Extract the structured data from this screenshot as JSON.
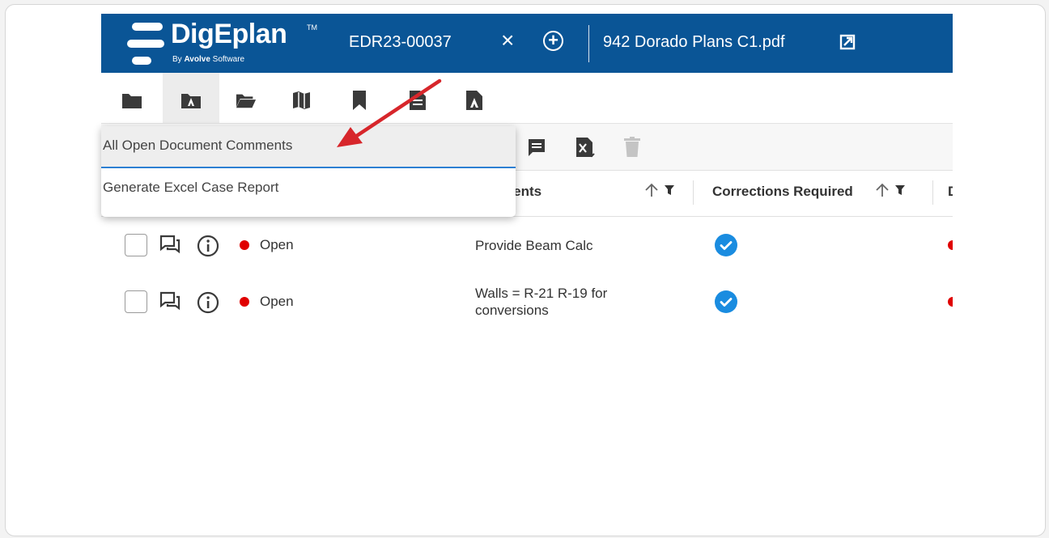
{
  "header": {
    "logo_text": "DigEplan",
    "logo_tm": "TM",
    "logo_sub_prefix": "By",
    "logo_sub_brand": "Avolve",
    "logo_sub_suffix": "Software",
    "case_id": "EDR23-00037",
    "close_glyph": "×",
    "add_glyph": "+",
    "document_name": "942 Dorado Plans C1.pdf"
  },
  "toolbar": {
    "icons": [
      "folder-icon",
      "folder-tag-icon",
      "folder-open-icon",
      "map-icon",
      "bookmark-icon",
      "document-icon",
      "document-tag-icon"
    ],
    "active_index": 1
  },
  "actions": {
    "icons": [
      "comment-icon",
      "excel-export-icon",
      "trash-icon"
    ]
  },
  "dropdown": {
    "items": [
      {
        "label": "All Open Document Comments",
        "highlighted": true
      },
      {
        "label": "Generate Excel Case Report",
        "highlighted": false
      }
    ]
  },
  "table": {
    "headers": {
      "comments": "ments",
      "corrections": "Corrections Required",
      "next": "D"
    },
    "rows": [
      {
        "status": "Open",
        "comment_line1": "Provide Beam Calc",
        "comment_line2": "",
        "corrections_required": true
      },
      {
        "status": "Open",
        "comment_line1": "Walls = R-21 R-19 for",
        "comment_line2": "conversions",
        "corrections_required": true
      }
    ]
  },
  "colors": {
    "header_bg": "#0a5596",
    "status_open": "#e00000",
    "check_blue": "#1a8ce0",
    "arrow_red": "#d7262b"
  }
}
